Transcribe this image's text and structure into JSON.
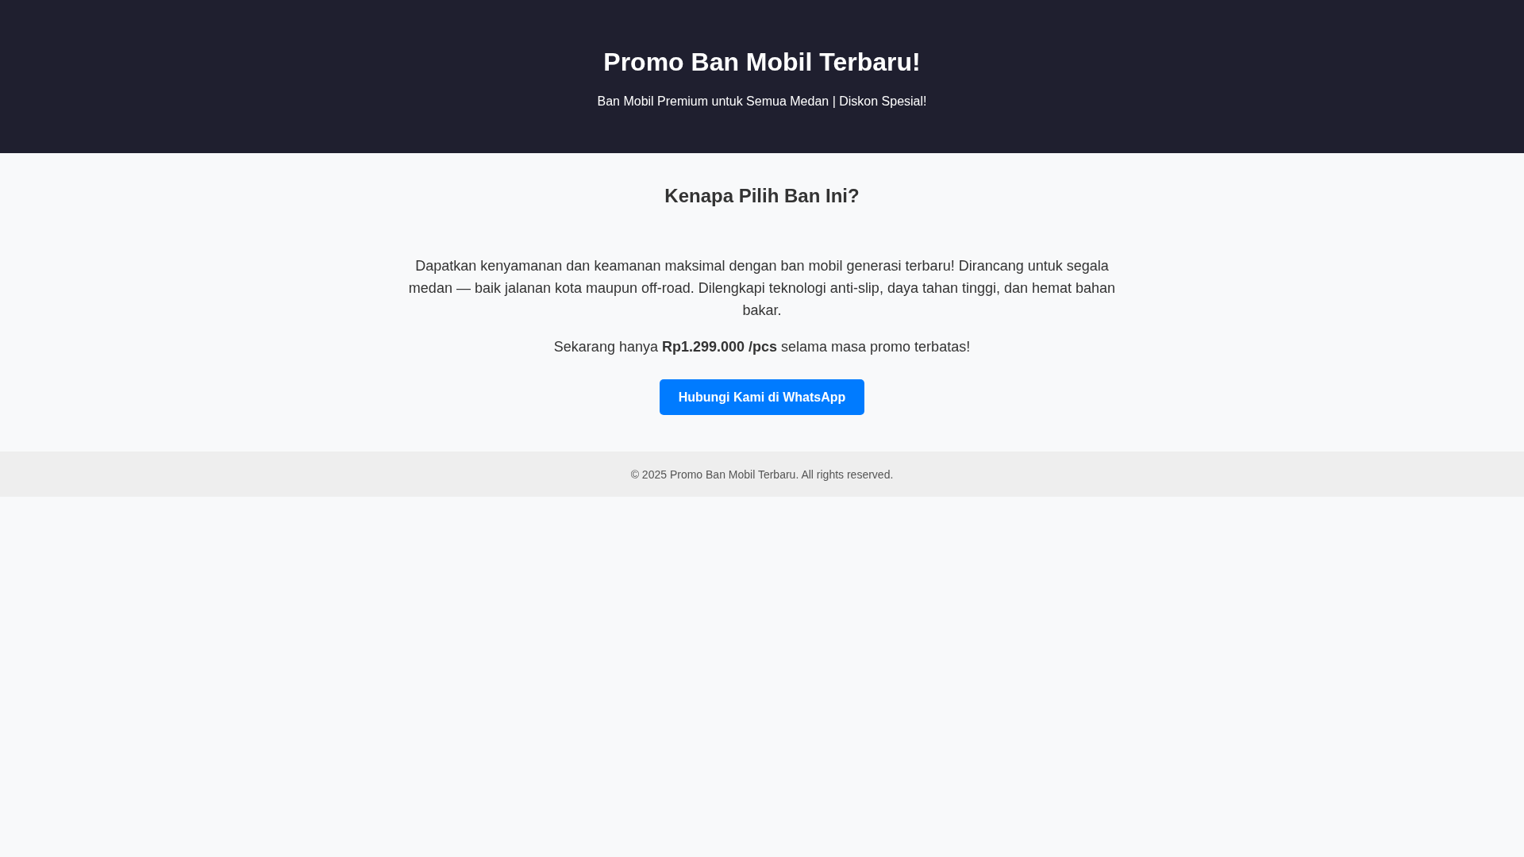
{
  "header": {
    "title": "Promo Ban Mobil Terbaru!",
    "subtitle": "Ban Mobil Premium untuk Semua Medan | Diskon Spesial!"
  },
  "section": {
    "heading": "Kenapa Pilih Ban Ini?",
    "description": "Dapatkan kenyamanan dan keamanan maksimal dengan ban mobil generasi terbaru! Dirancang untuk segala medan — baik jalanan kota maupun off-road. Dilengkapi teknologi anti-slip, daya tahan tinggi, dan hemat bahan bakar.",
    "price_line": "Sekarang hanya **Rp1.299.000 /pcs** selama masa promo terbatas!",
    "button": "Hubungi Kami di WhatsApp"
  },
  "footer": {
    "text": "© 2025 Promo Ban Mobil Terbaru. All rights reserved."
  }
}
